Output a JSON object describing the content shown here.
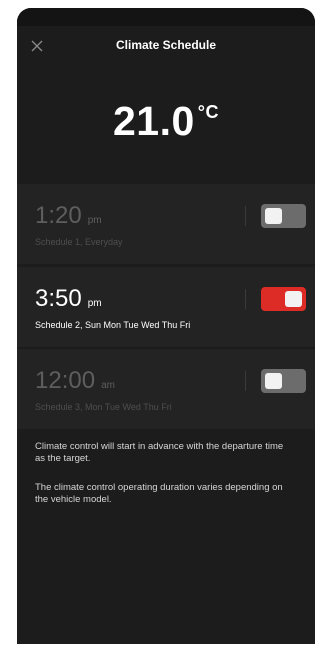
{
  "header": {
    "title": "Climate Schedule"
  },
  "temperature": {
    "value": "21.0",
    "unit": "°C"
  },
  "schedules": [
    {
      "time": "1:20",
      "period": "pm",
      "description": "Schedule 1, Everyday",
      "enabled": false
    },
    {
      "time": "3:50",
      "period": "pm",
      "description": "Schedule 2, Sun Mon Tue Wed Thu Fri",
      "enabled": true
    },
    {
      "time": "12:00",
      "period": "am",
      "description": "Schedule 3, Mon Tue Wed Thu Fri",
      "enabled": false
    }
  ],
  "notes": [
    "Climate control will start in advance with the departure time as the target.",
    "The climate control operating duration varies depending on the vehicle model."
  ],
  "colors": {
    "background": "#1c1c1c",
    "card": "#232323",
    "toggle_on": "#dd2b25",
    "toggle_off": "#6c6c6c"
  },
  "icons": {
    "close": "close-icon"
  }
}
